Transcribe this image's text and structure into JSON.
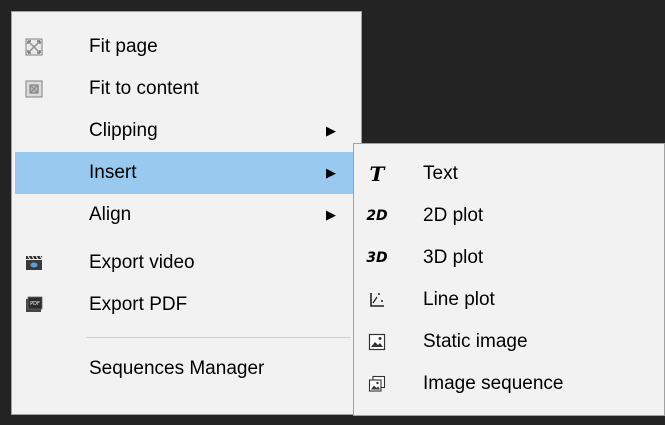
{
  "main_menu": {
    "items": [
      {
        "label": "Fit page",
        "icon": "fit-page-icon"
      },
      {
        "label": "Fit to content",
        "icon": "fit-to-content-icon"
      },
      {
        "label": "Clipping",
        "submenu": true
      },
      {
        "label": "Insert",
        "submenu": true,
        "highlighted": true
      },
      {
        "label": "Align",
        "submenu": true
      },
      {
        "label": "Export video",
        "icon": "video-icon"
      },
      {
        "label": "Export PDF",
        "icon": "pdf-icon"
      },
      {
        "label": "Sequences Manager"
      }
    ],
    "arrow_glyph": "▶"
  },
  "insert_submenu": {
    "items": [
      {
        "label": "Text",
        "icon_text": "T",
        "icon": "text-icon"
      },
      {
        "label": "2D plot",
        "icon_text": "2D",
        "icon": "2d-plot-icon"
      },
      {
        "label": "3D plot",
        "icon_text": "3D",
        "icon": "3d-plot-icon"
      },
      {
        "label": "Line plot",
        "icon": "line-plot-icon"
      },
      {
        "label": "Static image",
        "icon": "static-image-icon"
      },
      {
        "label": "Image sequence",
        "icon": "image-sequence-icon"
      }
    ]
  }
}
